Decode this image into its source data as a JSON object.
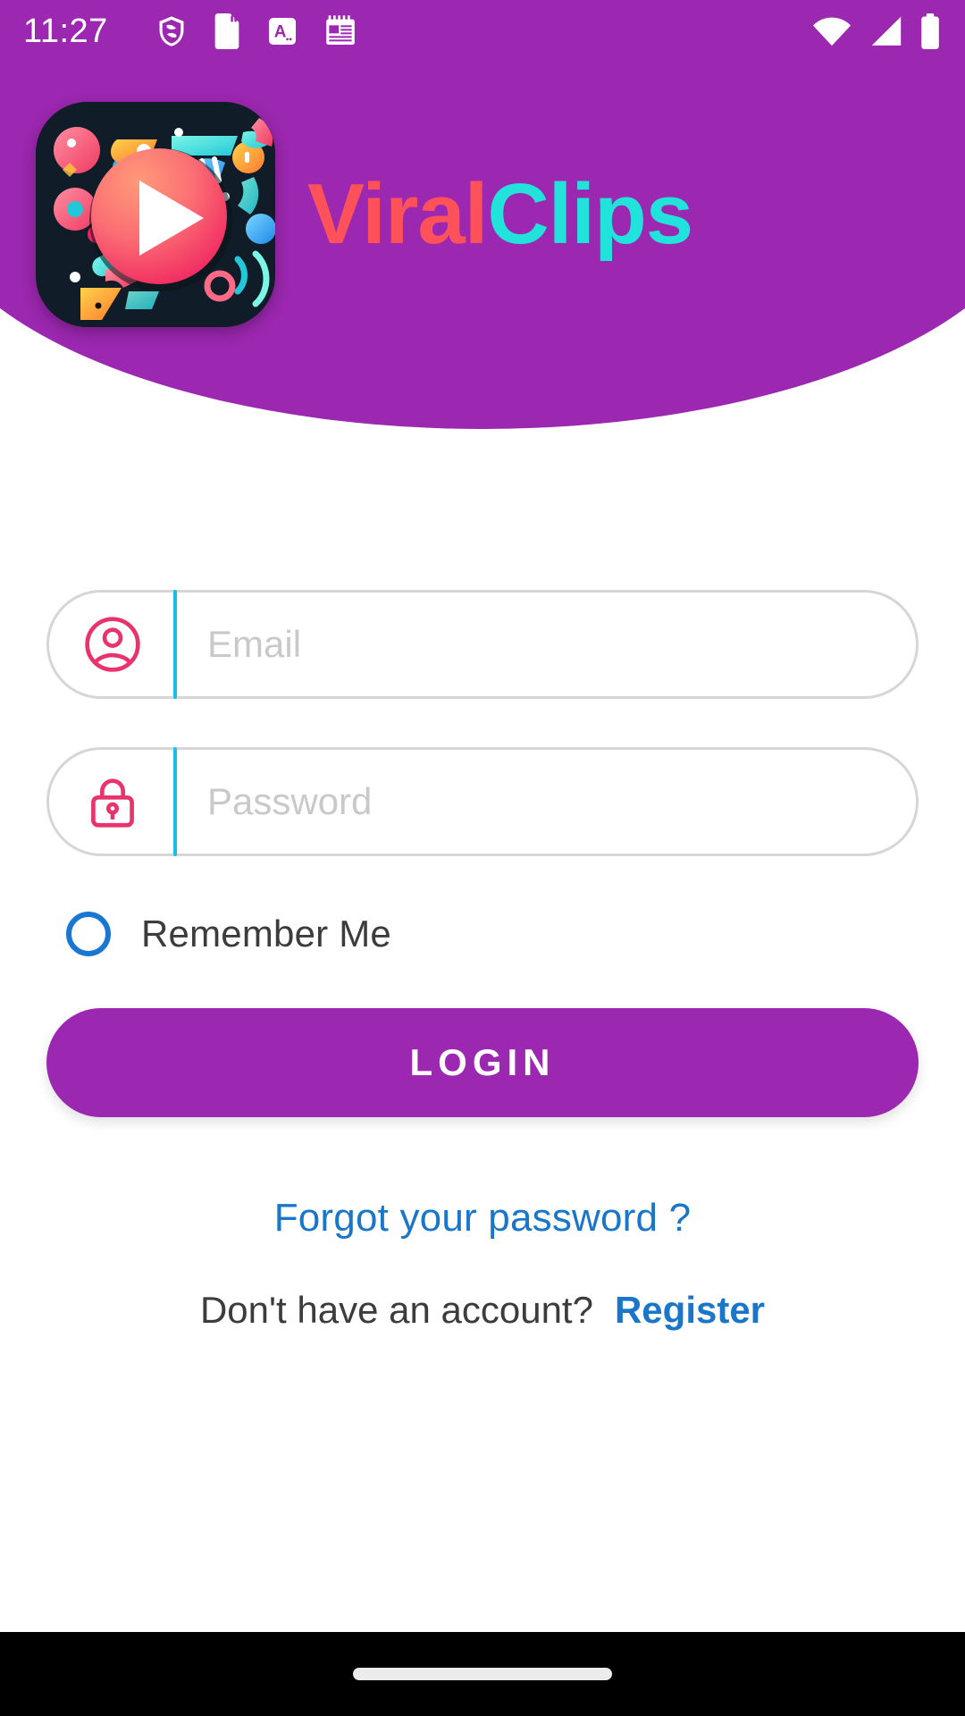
{
  "status_bar": {
    "time": "11:27",
    "left_icons": [
      "shield-icon",
      "sd-card-icon",
      "letter-a-icon",
      "calendar-icon"
    ],
    "right_icons": [
      "wifi-icon",
      "cellular-signal-icon",
      "battery-icon"
    ]
  },
  "brand": {
    "logo_icon": "viralclips-play-logo",
    "name_part1": "Viral",
    "name_part2": "Clips",
    "color_part1": "#FF5159",
    "color_part2": "#22E3DC",
    "header_color": "#9C27B0"
  },
  "form": {
    "email": {
      "icon": "person-icon",
      "placeholder": "Email",
      "value": ""
    },
    "password": {
      "icon": "lock-icon",
      "placeholder": "Password",
      "value": ""
    },
    "remember_me": {
      "label": "Remember Me",
      "checked": false,
      "color": "#1976D2"
    },
    "login_button": {
      "label": "LOGIN",
      "color": "#9C27B0"
    },
    "forgot_password": {
      "label": "Forgot your password ?",
      "color": "#1976C8"
    },
    "signup": {
      "prompt": "Don't have an account?",
      "link": "Register",
      "link_color": "#1976C8"
    },
    "accent_divider_color": "#18BEE8",
    "field_icon_color": "#E8336D"
  },
  "nav_bar": {
    "gesture_pill": "home-gesture-pill"
  }
}
